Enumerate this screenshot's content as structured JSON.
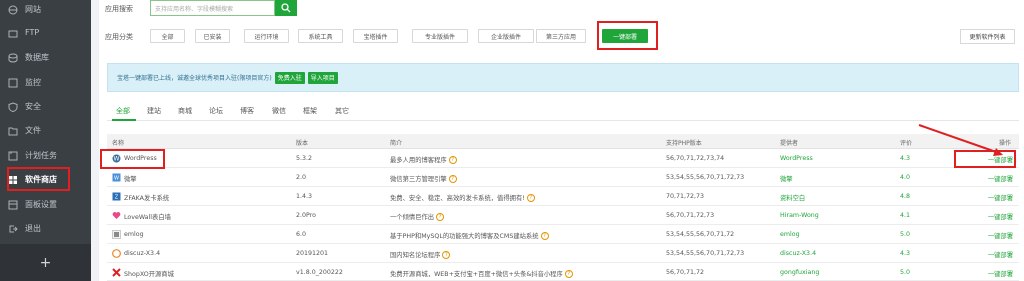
{
  "sidebar": {
    "items": [
      {
        "label": "网站",
        "icon": "globe-icon"
      },
      {
        "label": "FTP",
        "icon": "folder-icon"
      },
      {
        "label": "数据库",
        "icon": "database-icon"
      },
      {
        "label": "监控",
        "icon": "monitor-icon"
      },
      {
        "label": "安全",
        "icon": "shield-icon"
      },
      {
        "label": "文件",
        "icon": "file-icon"
      },
      {
        "label": "计划任务",
        "icon": "clock-icon"
      },
      {
        "label": "软件商店",
        "icon": "store-icon"
      },
      {
        "label": "面板设置",
        "icon": "gear-icon"
      },
      {
        "label": "退出",
        "icon": "logout-icon"
      }
    ],
    "add_label": "+"
  },
  "search": {
    "label": "应用搜索",
    "placeholder": "支持应用名称、字段模糊搜索"
  },
  "categories": {
    "label": "应用分类",
    "items": [
      "全部",
      "已安装",
      "运行环境",
      "系统工具",
      "宝塔插件",
      "专业版插件",
      "企业版插件",
      "第三方应用",
      "一键部署"
    ],
    "selected": "一键部署",
    "update_label": "更新软件列表"
  },
  "banner": {
    "text": "宝塔一键部署已上线，诚邀全球优秀项目入驻(限项目官方)",
    "btn_join": "免费入驻",
    "btn_import": "导入项目"
  },
  "tabs": [
    "全部",
    "建站",
    "商城",
    "论坛",
    "博客",
    "微信",
    "框架",
    "其它"
  ],
  "active_tab": "全部",
  "table": {
    "headers": [
      "名称",
      "版本",
      "简介",
      "支持PHP版本",
      "提供者",
      "评价",
      "操作"
    ],
    "rows": [
      {
        "name": "WordPress",
        "version": "5.3.2",
        "desc": "最多人用的博客程序",
        "php": "56,70,71,72,73,74",
        "provider": "WordPress",
        "score": "4.3",
        "op": "一键部署"
      },
      {
        "name": "微擎",
        "version": "2.0",
        "desc": "微信第三方管理引擎",
        "php": "53,54,55,56,70,71,72,73",
        "provider": "微擎",
        "score": "4.0",
        "op": "一键部署"
      },
      {
        "name": "ZFAKA发卡系统",
        "version": "1.4.3",
        "desc": "免费、安全、稳定、高效的发卡系统，值得拥有!",
        "php": "70,71,72,73",
        "provider": "资料空白",
        "score": "4.8",
        "op": "一键部署"
      },
      {
        "name": "LoveWall表白墙",
        "version": "2.0Pro",
        "desc": "一个倾情巨作出",
        "php": "56,70,71,72,73",
        "provider": "Hiram-Wong",
        "score": "4.1",
        "op": "一键部署"
      },
      {
        "name": "emlog",
        "version": "6.0",
        "desc": "基于PHP和MySQL的功能强大的博客及CMS建站系统",
        "php": "53,54,55,56,70,71,72",
        "provider": "emlog",
        "score": "5.0",
        "op": "一键部署"
      },
      {
        "name": "discuz-X3.4",
        "version": "20191201",
        "desc": "国内知名论坛程序",
        "php": "53,54,55,56,70,71,72,73",
        "provider": "discuz-X3.4",
        "score": "4.3",
        "op": "一键部署"
      },
      {
        "name": "ShopXO开源商城",
        "version": "v1.8.0_200222",
        "desc": "免费开源商城，WEB+支付宝+百度+微信+头条&抖音小程序",
        "php": "56,70,71,72",
        "provider": "gongfuxiang",
        "score": "5.0",
        "op": "一键部署"
      }
    ]
  },
  "colors": {
    "accent": "#20a53a",
    "sidebar": "#3a3f44",
    "highlight": "#e02020"
  }
}
